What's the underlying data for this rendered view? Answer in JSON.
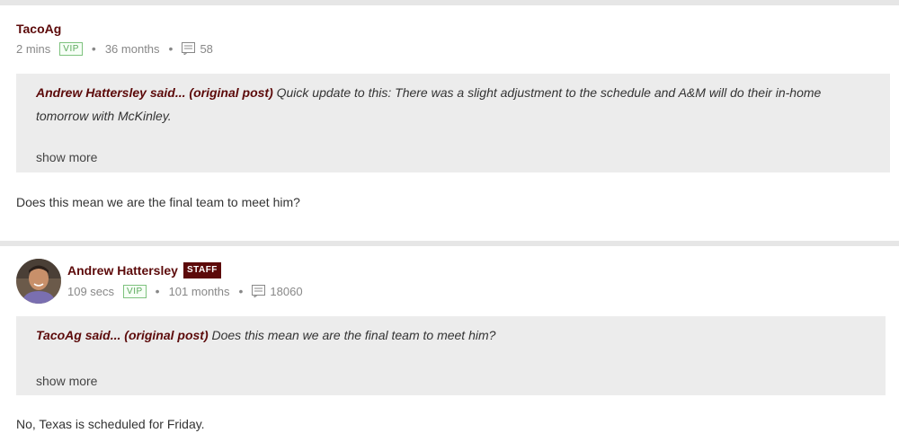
{
  "posts": [
    {
      "author": "TacoAg",
      "time": "2 mins",
      "vip": "VIP",
      "tenure": "36 months",
      "post_count": "58",
      "quote": {
        "quoted_author_said": "Andrew Hattersley said...",
        "original_post_link": "(original post)",
        "text": "Quick update to this: There was a slight adjustment to the schedule and A&M will do their in-home tomorrow with McKinley.",
        "show_more": "show more"
      },
      "body": "Does this mean we are the final team to meet him?"
    },
    {
      "author": "Andrew Hattersley",
      "badge": "STAFF",
      "time": "109 secs",
      "vip": "VIP",
      "tenure": "101 months",
      "post_count": "18060",
      "quote": {
        "quoted_author_said": "TacoAg said...",
        "original_post_link": "(original post)",
        "text": "Does this mean we are the final team to meet him?",
        "show_more": "show more"
      },
      "body": "No, Texas is scheduled for Friday."
    }
  ],
  "colors": {
    "maroon": "#5c0a0a",
    "vip_green": "#5aa85a",
    "quote_bg": "#ececec",
    "meta_gray": "#888888"
  }
}
